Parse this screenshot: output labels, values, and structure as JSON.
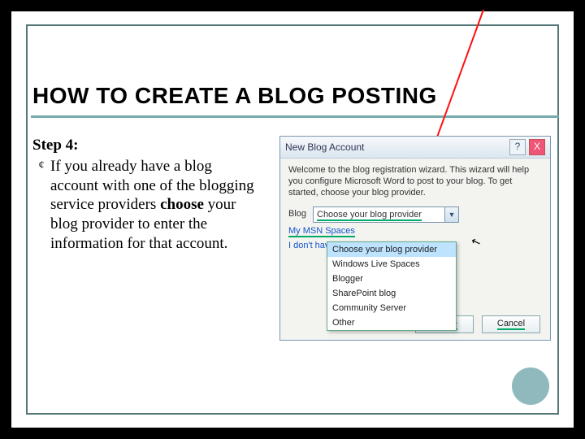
{
  "title": "HOW TO CREATE A BLOG POSTING",
  "step_label": "Step 4:",
  "bullet_glyph": "¢",
  "bullet_before": "If you already have a blog account with one of the blogging service providers ",
  "bullet_bold": "choose ",
  "bullet_after": "your blog provider to enter the information for that account.",
  "dialog": {
    "title": "New Blog Account",
    "help": "?",
    "close": "X",
    "welcome": "Welcome to the blog registration wizard. This wizard will help you configure Microsoft Word to post to your blog. To get started, choose your blog provider.",
    "field_label": "Blog",
    "selected": "Choose your blog provider",
    "link_myspace": "My MSN Spaces",
    "link_idont": "I don't have a blog yet",
    "btn_next": "Next >",
    "btn_cancel": "Cancel"
  },
  "options": [
    "Choose your blog provider",
    "Windows Live Spaces",
    "Blogger",
    "SharePoint blog",
    "Community Server",
    "Other"
  ],
  "cursor_glyph": "↖"
}
